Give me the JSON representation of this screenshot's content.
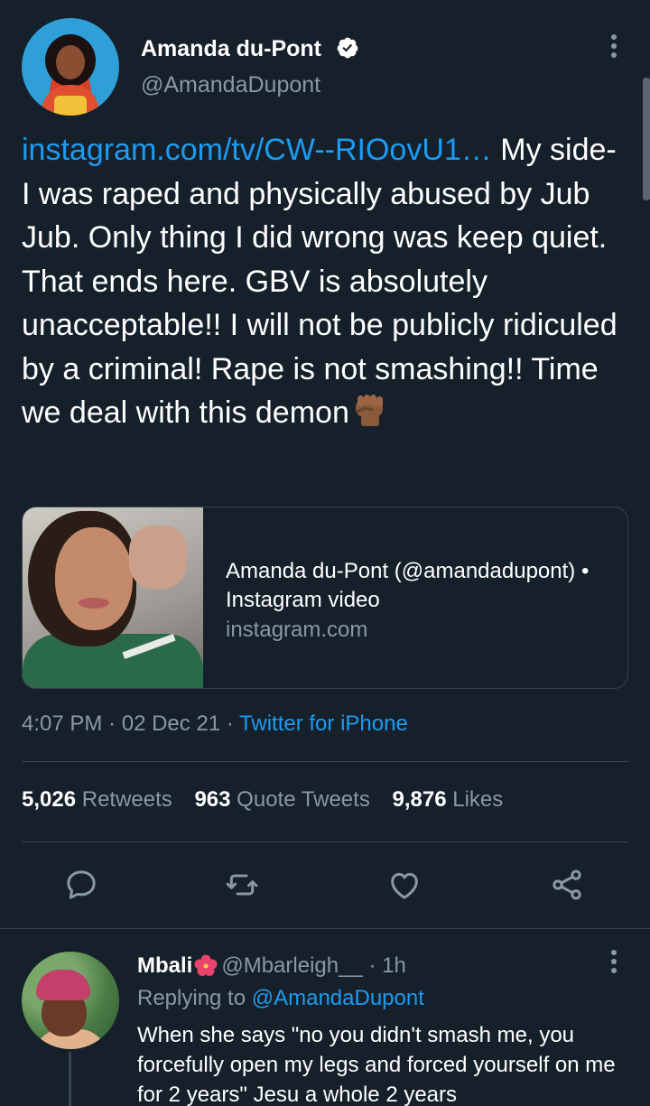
{
  "colors": {
    "background": "#15202b",
    "accent": "#1d9bf0",
    "secondary_text": "#8899a6",
    "divider": "#38444d"
  },
  "tweet": {
    "author_name": "Amanda du-Pont",
    "author_handle": "@AmandaDupont",
    "verified_icon": "verified-badge-icon",
    "link_text": "instagram.com/tv/CW--RIOovU1…",
    "text_after_link": " My side- I was raped and physically abused by Jub Jub. Only thing I did wrong was keep quiet. That ends here. GBV is absolutely unacceptable!! I will not be publicly ridiculed by a criminal! Rape is not smashing!! Time we deal with this demon",
    "trailing_emoji": "raised-fist-icon",
    "card": {
      "title": "Amanda du-Pont (@amandadupont) • Instagram video",
      "domain": "instagram.com"
    },
    "time": "4:07 PM",
    "date": "02 Dec 21",
    "separator": "·",
    "source": "Twitter for iPhone",
    "stats": {
      "retweets_count": "5,026",
      "retweets_label": "Retweets",
      "quotes_count": "963",
      "quotes_label": "Quote Tweets",
      "likes_count": "9,876",
      "likes_label": "Likes"
    },
    "actions": [
      "reply-icon",
      "retweet-icon",
      "like-icon",
      "share-icon"
    ]
  },
  "reply": {
    "author_name": "Mbali",
    "author_emoji": "hibiscus-icon",
    "author_handle": "@Mbarleigh__",
    "dot": "·",
    "time": "1h",
    "replying_prefix": "Replying to",
    "replying_to": "@AmandaDupont",
    "text": "When she says \"no you didn't smash me, you forcefully open my legs and forced yourself on me for 2 years\" Jesu a whole 2 years"
  }
}
